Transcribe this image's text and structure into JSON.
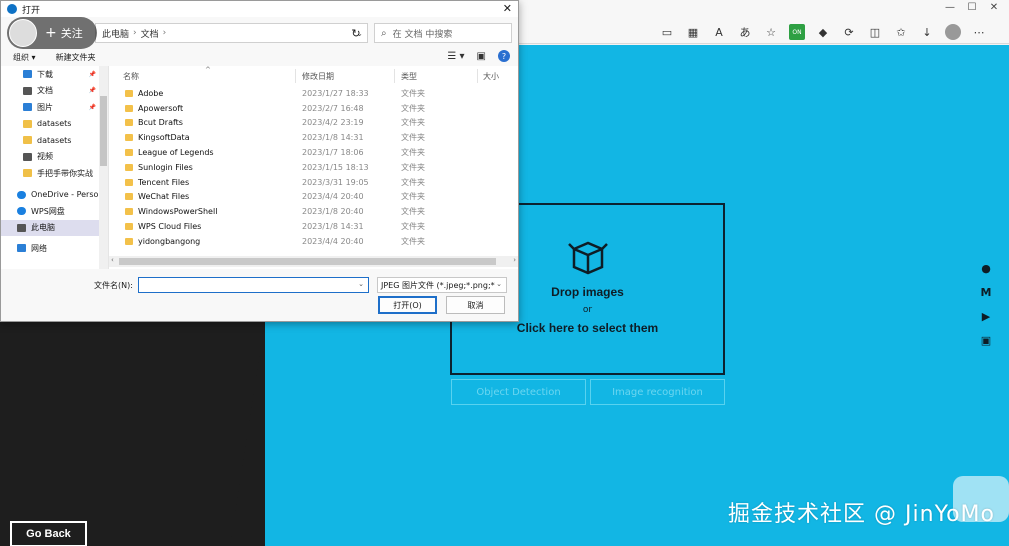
{
  "browser": {
    "toolbar_icons": [
      "reading-view-icon",
      "qr-icon",
      "read-aloud-icon",
      "translate-icon",
      "favorite-star-icon",
      "extension-on-icon",
      "extension-arrow-icon",
      "extensions-icon",
      "split-screen-icon",
      "favorites-icon",
      "download-icon",
      "profile-icon",
      "more-icon"
    ],
    "window_controls": [
      "—",
      "☐",
      "✕"
    ]
  },
  "dialog": {
    "title": "打开",
    "close": "✕",
    "breadcrumb": [
      "此电脑",
      "文档"
    ],
    "search_placeholder": "在 文档 中搜索",
    "follow_label": "关注",
    "organize_label": "组织 ▾",
    "new_folder_label": "新建文件夹",
    "nav_items": [
      {
        "label": "下载",
        "icon": "download-arrow-icon",
        "pinned": true
      },
      {
        "label": "文档",
        "icon": "document-icon",
        "pinned": true
      },
      {
        "label": "图片",
        "icon": "pictures-icon",
        "pinned": true
      },
      {
        "label": "datasets",
        "icon": "folder-icon",
        "pinned": false
      },
      {
        "label": "datasets",
        "icon": "folder-icon",
        "pinned": false
      },
      {
        "label": "视频",
        "icon": "video-icon",
        "pinned": false
      },
      {
        "label": "手把手带你实战",
        "icon": "folder-icon",
        "pinned": false
      },
      {
        "label": "OneDrive - Perso",
        "icon": "onedrive-icon",
        "pinned": false
      },
      {
        "label": "WPS网盘",
        "icon": "wps-cloud-icon",
        "pinned": false
      },
      {
        "label": "此电脑",
        "icon": "computer-icon",
        "pinned": false
      },
      {
        "label": "网络",
        "icon": "network-icon",
        "pinned": false
      }
    ],
    "columns": {
      "name": "名称",
      "modified": "修改日期",
      "type": "类型",
      "size": "大小"
    },
    "files": [
      {
        "name": "Adobe",
        "modified": "2023/1/27 18:33",
        "type": "文件夹"
      },
      {
        "name": "Apowersoft",
        "modified": "2023/2/7 16:48",
        "type": "文件夹"
      },
      {
        "name": "Bcut Drafts",
        "modified": "2023/4/2 23:19",
        "type": "文件夹"
      },
      {
        "name": "KingsoftData",
        "modified": "2023/1/8 14:31",
        "type": "文件夹"
      },
      {
        "name": "League of Legends",
        "modified": "2023/1/7 18:06",
        "type": "文件夹"
      },
      {
        "name": "Sunlogin Files",
        "modified": "2023/1/15 18:13",
        "type": "文件夹"
      },
      {
        "name": "Tencent Files",
        "modified": "2023/3/31 19:05",
        "type": "文件夹"
      },
      {
        "name": "WeChat Files",
        "modified": "2023/4/4 20:40",
        "type": "文件夹"
      },
      {
        "name": "WindowsPowerShell",
        "modified": "2023/1/8 20:40",
        "type": "文件夹"
      },
      {
        "name": "WPS Cloud Files",
        "modified": "2023/1/8 14:31",
        "type": "文件夹"
      },
      {
        "name": "yidongbangong",
        "modified": "2023/4/4 20:40",
        "type": "文件夹"
      }
    ],
    "filename_label": "文件名(N):",
    "filename_value": "",
    "filetype_value": "JPEG 图片文件 (*.jpeg;*.png;*",
    "open_label": "打开(O)",
    "cancel_label": "取消"
  },
  "page": {
    "drop_title": "Drop images",
    "drop_or": "or",
    "drop_click": "Click here to select them",
    "mode_buttons": [
      "Object Detection",
      "Image recognition"
    ],
    "social_icons": [
      "github-icon",
      "medium-icon",
      "youtube-icon",
      "twitch-icon"
    ],
    "go_back": "Go Back",
    "watermark": "掘金技术社区 @ JinYoMo"
  },
  "colors": {
    "page_bg": "#12b6e4",
    "dark_panel": "#1e1e1e",
    "accent_blue": "#1e6fc9"
  }
}
